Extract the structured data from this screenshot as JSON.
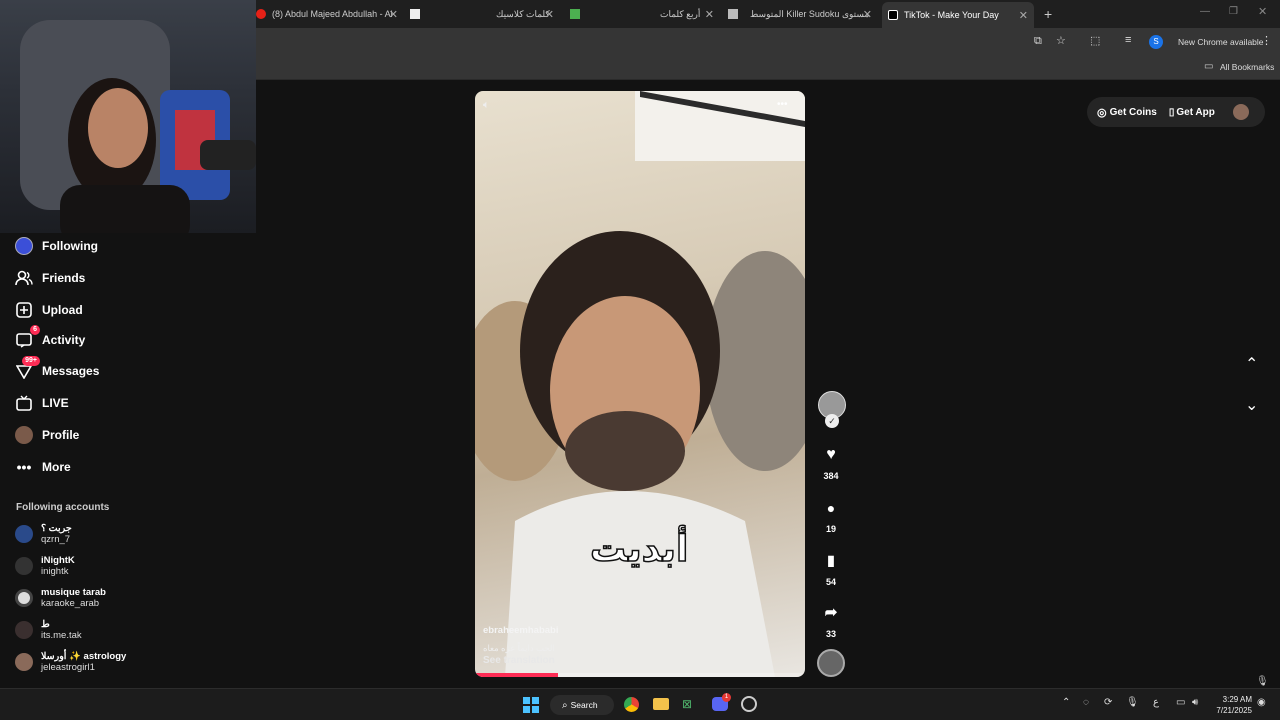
{
  "browser": {
    "tabs": [
      {
        "title": "(8) Abdul Majeed Abdullah - Al",
        "active": false
      },
      {
        "title": "كلمات كلاسيك",
        "active": false
      },
      {
        "title": "أربع كلمات",
        "active": false
      },
      {
        "title": "المتوسط Killer Sudoku مستوى",
        "active": false
      },
      {
        "title": "TikTok - Make Your Day",
        "active": true
      }
    ],
    "new_tab_symbol": "+",
    "profile_initial": "S",
    "update_label": "New Chrome available",
    "all_bookmarks_label": "All Bookmarks"
  },
  "sidebar": {
    "nav": [
      {
        "label": "Following",
        "icon": "following-icon",
        "badge": ""
      },
      {
        "label": "Friends",
        "icon": "friends-icon",
        "badge": ""
      },
      {
        "label": "Upload",
        "icon": "upload-icon",
        "badge": ""
      },
      {
        "label": "Activity",
        "icon": "activity-icon",
        "badge": "6"
      },
      {
        "label": "Messages",
        "icon": "messages-icon",
        "badge": "99+"
      },
      {
        "label": "LIVE",
        "icon": "live-icon",
        "badge": ""
      },
      {
        "label": "Profile",
        "icon": "profile-icon",
        "badge": ""
      },
      {
        "label": "More",
        "icon": "more-icon",
        "badge": ""
      }
    ],
    "following_title": "Following accounts",
    "accounts": [
      {
        "name": "جربت ؟",
        "username": "qzrn_7",
        "color": "#2a4a8a"
      },
      {
        "name": "iNightK",
        "username": "inightk",
        "color": "#333333"
      },
      {
        "name": "musique tarab",
        "username": "karaoke_arab",
        "color": "#dddddd"
      },
      {
        "name": "ط",
        "username": "its.me.tak",
        "color": "#3a2f2f"
      },
      {
        "name": "أورسلا ✨ astrology",
        "username": "jeleastrogirl1",
        "color": "#8a6a5a"
      }
    ]
  },
  "header": {
    "get_coins_label": "Get Coins",
    "get_app_label": "Get App"
  },
  "video": {
    "caption_overlay": "أبديت",
    "author": "ebraheemhababi",
    "description": "الحب دايماً عزه معاه",
    "see_translation": "See translation",
    "more_symbol": "•••",
    "progress": 0.25
  },
  "actions": {
    "likes": "384",
    "comments": "19",
    "saves": "54",
    "shares": "33"
  },
  "taskbar": {
    "search_label": "Search",
    "time": "3:29 AM",
    "date": "7/21/2025",
    "lang": "ع",
    "discord_badge": "1"
  },
  "colors": {
    "accent": "#fe2c55",
    "background": "#121212",
    "chrome_toolbar": "#353535"
  }
}
